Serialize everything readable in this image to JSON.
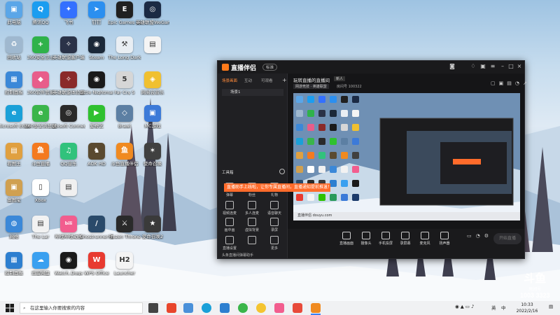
{
  "desktop": {
    "icons": [
      {
        "label": "此电脑",
        "color": "#5aa6e8",
        "glyph": "▣"
      },
      {
        "label": "腾讯QQ",
        "color": "#1b9df0",
        "glyph": "Q"
      },
      {
        "label": "飞书",
        "color": "#3370ff",
        "glyph": "✦"
      },
      {
        "label": "钉钉",
        "color": "#2b8ff0",
        "glyph": "➤"
      },
      {
        "label": "Epic Games Launcher",
        "color": "#202020",
        "glyph": "E"
      },
      {
        "label": "英雄联盟WeGame版",
        "color": "#1b2a44",
        "glyph": "◎"
      },
      {
        "label": "回收站",
        "color": "#9fb8cf",
        "glyph": "♻"
      },
      {
        "label": "360安全卫士",
        "color": "#2fb24a",
        "glyph": "+"
      },
      {
        "label": "英雄联盟客户端",
        "color": "#2a3248",
        "glyph": "✧"
      },
      {
        "label": "Steam",
        "color": "#1b2838",
        "glyph": "◉"
      },
      {
        "label": "The Long Dark",
        "color": "#e9eef3",
        "glyph": "⚒"
      },
      {
        "label": "",
        "color": "#f4f4f4",
        "glyph": "▤"
      },
      {
        "label": "控制面板",
        "color": "#3b88d8",
        "glyph": "▦"
      },
      {
        "label": "360软件管家",
        "color": "#e85d8a",
        "glyph": "◆"
      },
      {
        "label": "英雄联盟体验服",
        "color": "#8a2a2a",
        "glyph": "✧"
      },
      {
        "label": "Little Nightmares",
        "color": "#1a1a1a",
        "glyph": "◉"
      },
      {
        "label": "Far Cry 5",
        "color": "#d6d6d6",
        "glyph": "5"
      },
      {
        "label": "网易云音乐",
        "color": "#f0c030",
        "glyph": "◈"
      },
      {
        "label": "Microsoft Edge",
        "color": "#1aa0d8",
        "glyph": "e"
      },
      {
        "label": "360安全浏览器",
        "color": "#3ab54a",
        "glyph": "e"
      },
      {
        "label": "Ubisoft Connect",
        "color": "#2a2a2a",
        "glyph": "◎"
      },
      {
        "label": "爱奇艺",
        "color": "#2fc12f",
        "glyph": "▶"
      },
      {
        "label": "Brawl",
        "color": "#5c7fa3",
        "glyph": "◇"
      },
      {
        "label": "MC游戏",
        "color": "#3c7ad8",
        "glyph": "▣"
      },
      {
        "label": "看图王",
        "color": "#e0a040",
        "glyph": "▤"
      },
      {
        "label": "斗鱼直播",
        "color": "#f47a20",
        "glyph": "鱼"
      },
      {
        "label": "QQ音乐",
        "color": "#31c27c",
        "glyph": "♫"
      },
      {
        "label": "AOK HD",
        "color": "#5a4a30",
        "glyph": "♞"
      },
      {
        "label": "斗鱼直播伴侣",
        "color": "#f08a20",
        "glyph": "鱼"
      },
      {
        "label": "使命召唤",
        "color": "#404040",
        "glyph": "✶"
      },
      {
        "label": "富图宝",
        "color": "#d0a050",
        "glyph": "▣"
      },
      {
        "label": "Xbox",
        "color": "#ffffff",
        "glyph": "▯"
      },
      {
        "label": "",
        "color": "#f0f0f0",
        "glyph": "▤"
      },
      {
        "label": "",
        "color": "#ffffff",
        "glyph": ""
      },
      {
        "label": "",
        "color": "#ffffff",
        "glyph": ""
      },
      {
        "label": "",
        "color": "#ffffff",
        "glyph": ""
      },
      {
        "label": "网络",
        "color": "#3b88d8",
        "glyph": "◍"
      },
      {
        "label": "The Lar",
        "color": "#f2f2f2",
        "glyph": "▤"
      },
      {
        "label": "哔哩哔哩动画",
        "color": "#f25d8e",
        "glyph": "bili"
      },
      {
        "label": "Ghostrunner 赛博忍者",
        "color": "#2a4a6a",
        "glyph": "/"
      },
      {
        "label": "Frozen Throne",
        "color": "#2a2a2a",
        "glyph": "⚔"
      },
      {
        "label": "使命召唤2",
        "color": "#3a3a3a",
        "glyph": "★"
      },
      {
        "label": "控制面板",
        "color": "#2d7fd0",
        "glyph": "▦"
      },
      {
        "label": "迅雷网盘",
        "color": "#3aa0f0",
        "glyph": "☁"
      },
      {
        "label": "Watch_Dogs",
        "color": "#1a1a1a",
        "glyph": "◉"
      },
      {
        "label": "WPS Office",
        "color": "#e83a30",
        "glyph": "W"
      },
      {
        "label": "Launcher",
        "color": "#f4f4f4",
        "glyph": "H2"
      },
      {
        "label": "",
        "color": "#ffffff",
        "glyph": ""
      },
      {
        "label": "微信",
        "color": "#2dc100",
        "glyph": "◕"
      },
      {
        "label": "迅游 加速器一键安装",
        "color": "#2a9a5a",
        "glyph": "✈"
      },
      {
        "label": "360压缩",
        "color": "#3a7ad8",
        "glyph": "▦"
      },
      {
        "label": "魔兽争霸III",
        "color": "#1a3a6a",
        "glyph": "W"
      },
      {
        "label": "新建文本",
        "color": "#f4f4f4",
        "glyph": "▤"
      }
    ]
  },
  "app": {
    "brand": "直播伴侣",
    "version_badge": "标准",
    "tabs": [
      "场景画面",
      "互动",
      "可观看"
    ],
    "scene_label": "场景1",
    "tools_label": "工具箱",
    "tools": [
      {
        "label": "弹幕"
      },
      {
        "label": "粉丝"
      },
      {
        "label": "礼物"
      },
      {
        "label": "视频连麦"
      },
      {
        "label": "多人连麦"
      },
      {
        "label": "语音聊天"
      },
      {
        "label": "画中画"
      },
      {
        "label": "虚拟背景"
      },
      {
        "label": "录屏"
      },
      {
        "label": "直播设置"
      },
      {
        "label": "",
        "icon": "more-icon"
      },
      {
        "label": "更多"
      }
    ],
    "stream_title": "玩转直播的直播间",
    "stream_badge": "新人",
    "room_info": "房间号 100322",
    "stream_category": "网游竞技 · 英雄联盟",
    "room_id_short": "1003 3323",
    "bottom_items": [
      "直播画面",
      "摄像头",
      "手机投屏",
      "录屏幕",
      "麦克风",
      "扬声器"
    ],
    "start_button": "开始直播",
    "toast": "直播助手上线啦，让你专属直播间，直播通知提前推送！",
    "footer_notice": "头条直播间弹幕助手",
    "preview_url": "直播伴侣 douyu.com"
  },
  "taskbar": {
    "search_placeholder": "在这里输入你要搜索的内容",
    "clock_time": "10:33",
    "clock_date": "2022/2/16",
    "ime": "中",
    "lang_mode": "英"
  },
  "watermark": {
    "logo": "斗鱼",
    "sub": "房间号",
    "room": "1003 3323"
  }
}
